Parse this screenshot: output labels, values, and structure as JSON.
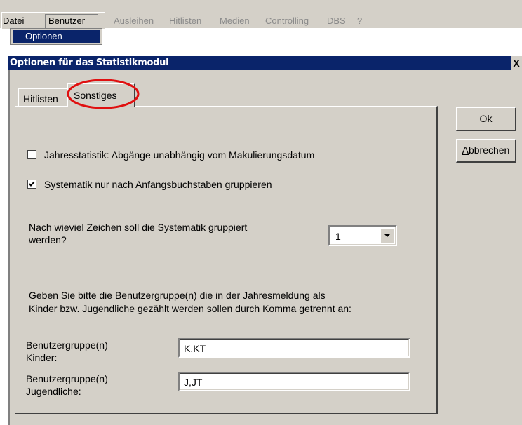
{
  "menubar": {
    "items": [
      {
        "label": "Datei",
        "enabled": true
      },
      {
        "label": "Benutzer",
        "enabled": true
      },
      {
        "label": "Ausleihen",
        "enabled": false
      },
      {
        "label": "Hitlisten",
        "enabled": false
      },
      {
        "label": "Medien",
        "enabled": false
      },
      {
        "label": "Controlling",
        "enabled": false
      },
      {
        "label": "DBS",
        "enabled": false
      },
      {
        "label": "?",
        "enabled": false
      }
    ],
    "dropdown": {
      "selected": "Optionen"
    }
  },
  "dialog": {
    "title": "Optionen für das Statistikmodul",
    "close_label": "X",
    "tabs": [
      {
        "label": "Hitlisten",
        "active": false
      },
      {
        "label": "Sonstiges",
        "active": true
      }
    ],
    "checkboxes": [
      {
        "label": "Jahresstatistik: Abgänge unabhängig vom Makulierungsdatum",
        "checked": false
      },
      {
        "label": "Systematik nur nach Anfangsbuchstaben gruppieren",
        "checked": true
      }
    ],
    "group_question": {
      "line1": "Nach wieviel Zeichen soll die Systematik gruppiert",
      "line2": "werden?",
      "value": "1"
    },
    "instruction": {
      "line1": "Geben Sie bitte die Benutzergruppe(n) die in der Jahresmeldung als",
      "line2": "Kinder bzw. Jugendliche gezählt werden sollen durch Komma getrennt an:"
    },
    "fields": [
      {
        "label_line1": "Benutzergruppe(n)",
        "label_line2": "Kinder:",
        "value": "K,KT"
      },
      {
        "label_line1": "Benutzergruppe(n)",
        "label_line2": "Jugendliche:",
        "value": "J,JT"
      }
    ],
    "buttons": {
      "ok": {
        "mnemonic": "O",
        "rest": "k"
      },
      "cancel": {
        "mnemonic": "A",
        "rest": "bbrechen"
      }
    },
    "highlight_color": "#e01010",
    "titlebar_color": "#0a246a"
  }
}
